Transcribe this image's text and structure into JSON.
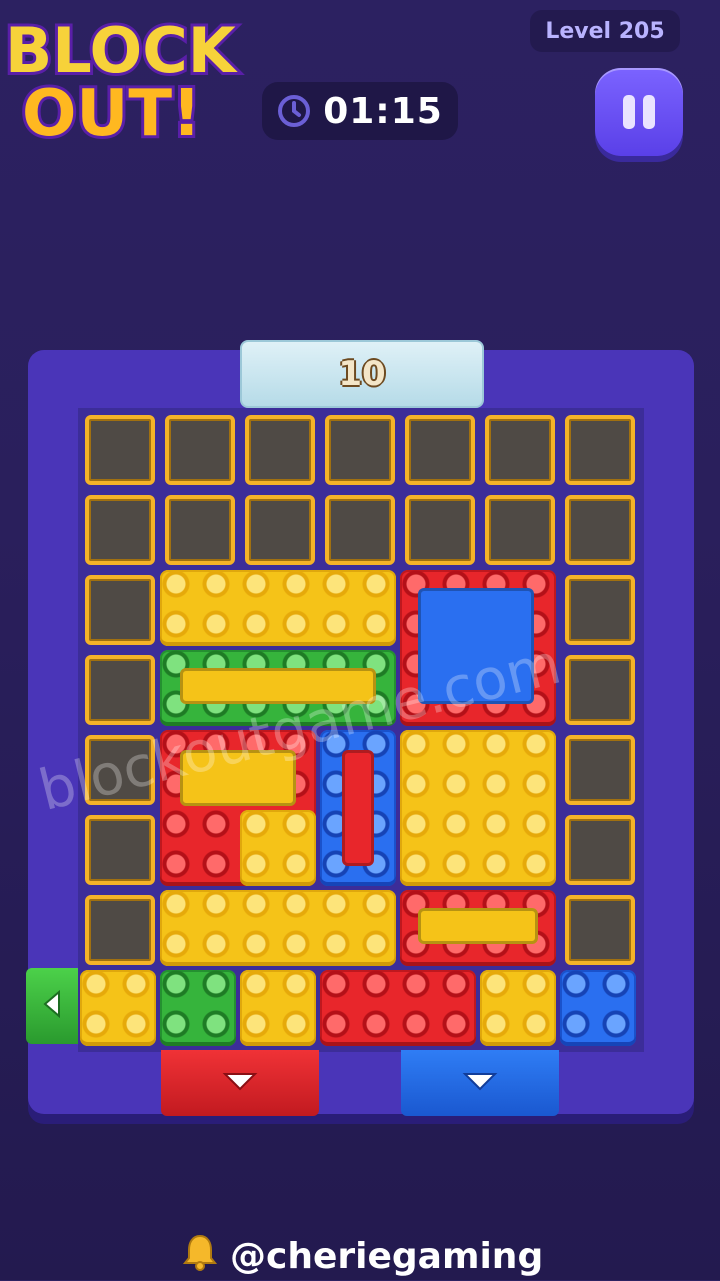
{
  "logo": {
    "line1": "BLOCK",
    "line2": "OUT!"
  },
  "level": {
    "label": "Level 205"
  },
  "timer": {
    "value": "01:15",
    "icon": "clock-icon"
  },
  "pause": {
    "icon": "pause-icon"
  },
  "board": {
    "moves_remaining": "10",
    "watermark": "blockoutgame.com"
  },
  "exits": [
    {
      "color": "green",
      "side": "left",
      "icon": "arrow-left-icon"
    },
    {
      "color": "red",
      "side": "bottom",
      "icon": "arrow-down-icon"
    },
    {
      "color": "blue",
      "side": "bottom",
      "icon": "arrow-down-icon"
    }
  ],
  "colors": {
    "yellow": "#f5c318",
    "red": "#e8262b",
    "blue": "#2a6ff0",
    "green": "#36b43c",
    "frame": "#4a35b8",
    "background": "#2a1f5c"
  },
  "credit": {
    "handle": "@cheriegaming",
    "icon": "bell-icon"
  }
}
